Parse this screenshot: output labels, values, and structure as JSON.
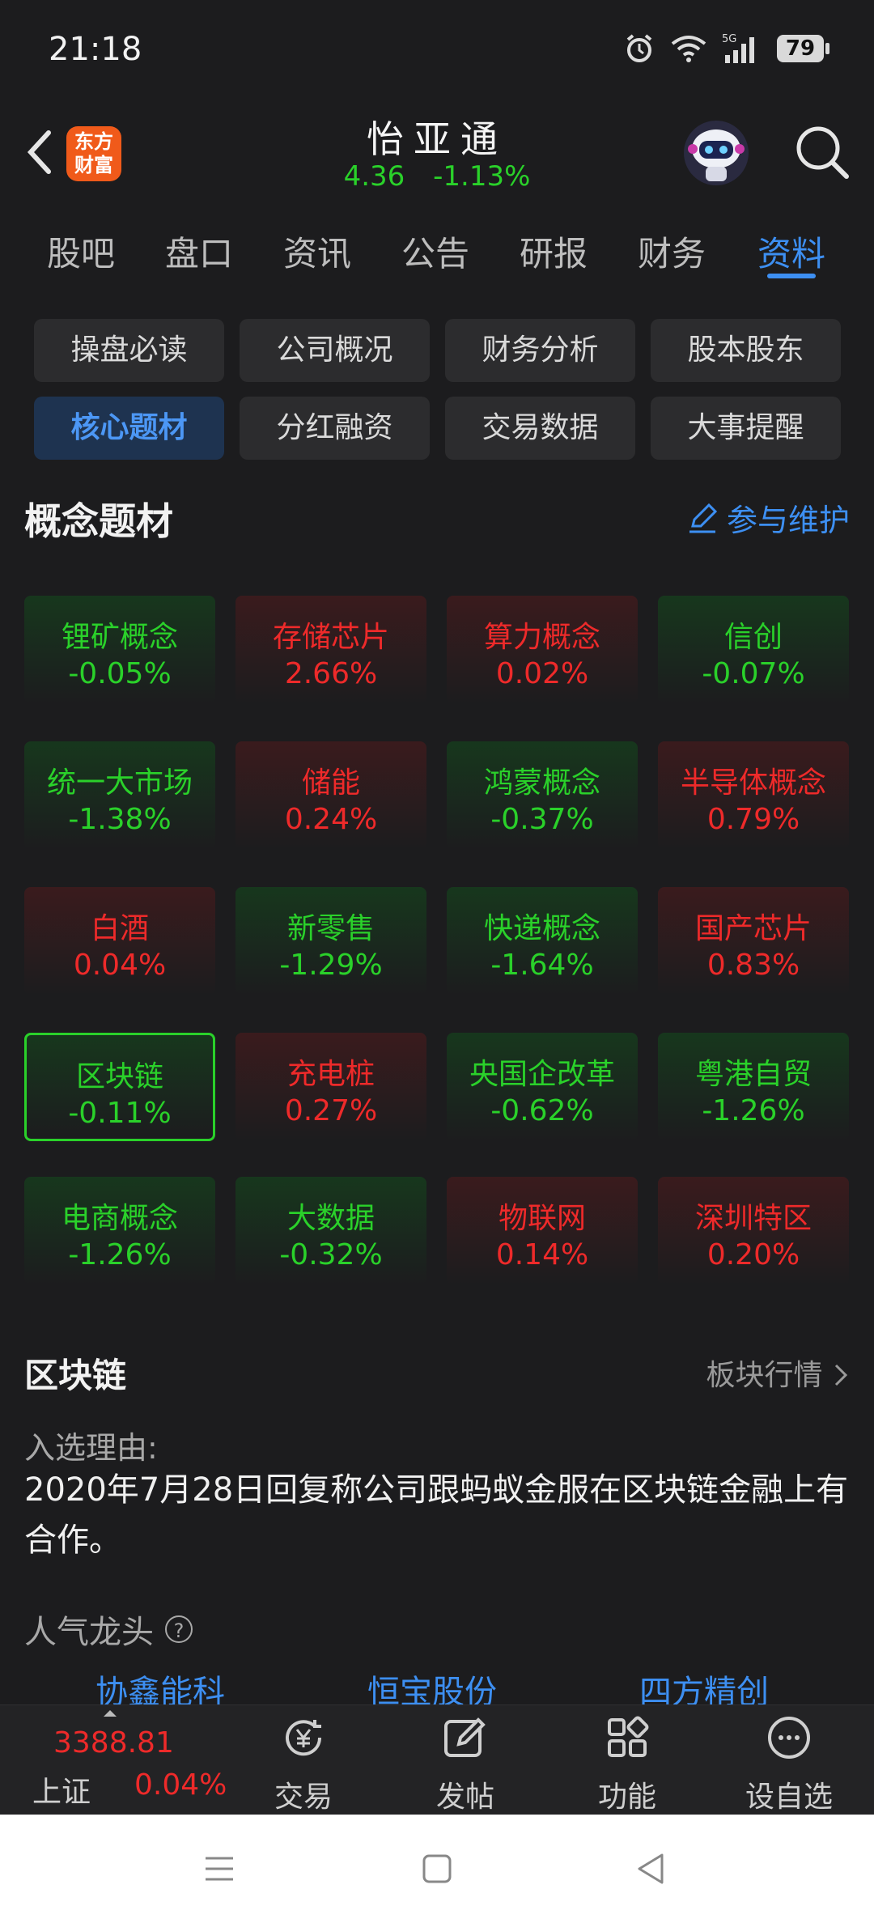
{
  "status_bar": {
    "time": "21:18",
    "network": "5G",
    "battery": "79"
  },
  "header": {
    "logo_line1": "东方",
    "logo_line2": "财富",
    "stock_name": "怡亚通",
    "price": "4.36",
    "change_pct": "-1.13%"
  },
  "main_tabs": [
    "股吧",
    "盘口",
    "资讯",
    "公告",
    "研报",
    "财务",
    "资料"
  ],
  "sub_buttons": [
    "操盘必读",
    "公司概况",
    "财务分析",
    "股本股东",
    "核心题材",
    "分红融资",
    "交易数据",
    "大事提醒"
  ],
  "concept_section": {
    "title": "概念题材",
    "participate": "参与维护"
  },
  "concepts": [
    {
      "name": "锂矿概念",
      "change": "-0.05%",
      "dir": "down"
    },
    {
      "name": "存储芯片",
      "change": "2.66%",
      "dir": "up"
    },
    {
      "name": "算力概念",
      "change": "0.02%",
      "dir": "up"
    },
    {
      "name": "信创",
      "change": "-0.07%",
      "dir": "down"
    },
    {
      "name": "统一大市场",
      "change": "-1.38%",
      "dir": "down"
    },
    {
      "name": "储能",
      "change": "0.24%",
      "dir": "up"
    },
    {
      "name": "鸿蒙概念",
      "change": "-0.37%",
      "dir": "down"
    },
    {
      "name": "半导体概念",
      "change": "0.79%",
      "dir": "up"
    },
    {
      "name": "白酒",
      "change": "0.04%",
      "dir": "up"
    },
    {
      "name": "新零售",
      "change": "-1.29%",
      "dir": "down"
    },
    {
      "name": "快递概念",
      "change": "-1.64%",
      "dir": "down"
    },
    {
      "name": "国产芯片",
      "change": "0.83%",
      "dir": "up"
    },
    {
      "name": "区块链",
      "change": "-0.11%",
      "dir": "down",
      "selected": true
    },
    {
      "name": "充电桩",
      "change": "0.27%",
      "dir": "up"
    },
    {
      "name": "央国企改革",
      "change": "-0.62%",
      "dir": "down"
    },
    {
      "name": "粤港自贸",
      "change": "-1.26%",
      "dir": "down"
    },
    {
      "name": "电商概念",
      "change": "-1.26%",
      "dir": "down"
    },
    {
      "name": "大数据",
      "change": "-0.32%",
      "dir": "down"
    },
    {
      "name": "物联网",
      "change": "0.14%",
      "dir": "up"
    },
    {
      "name": "深圳特区",
      "change": "0.20%",
      "dir": "up"
    }
  ],
  "detail": {
    "title": "区块链",
    "sector_link": "板块行情",
    "reason_label": "入选理由:",
    "reason_text": "2020年7月28日回复称公司跟蚂蚁金服在区块链金融上有合作。",
    "popular_label": "人气龙头",
    "leaders": [
      "协鑫能科",
      "恒宝股份",
      "四方精创"
    ]
  },
  "bottom_bar": {
    "index_value": "3388.81",
    "index_name": "上证",
    "index_change": "0.04%",
    "items": [
      "交易",
      "发帖",
      "功能",
      "设自选"
    ]
  },
  "colors": {
    "up": "#ee2a2a",
    "down": "#2ad12a",
    "accent": "#3d8ff2"
  },
  "icons": [
    "back-arrow-icon",
    "robot-avatar-icon",
    "search-icon",
    "edit-pencil-icon",
    "help-icon",
    "chevron-right-icon",
    "yuan-refresh-icon",
    "compose-icon",
    "grid-icon",
    "more-dots-icon"
  ]
}
